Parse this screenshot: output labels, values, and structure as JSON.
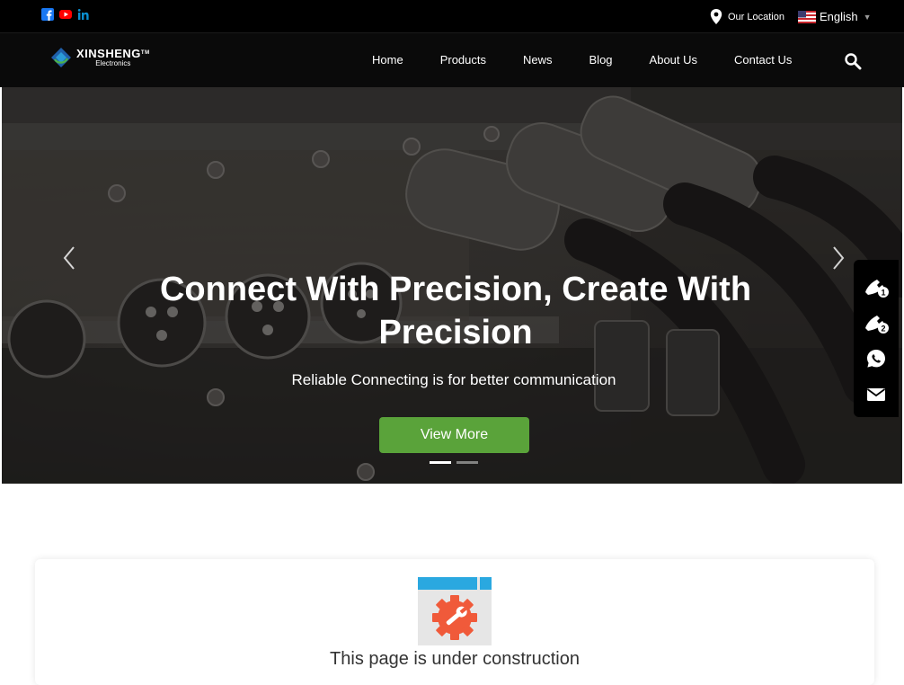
{
  "topbar": {
    "social": [
      "facebook-icon",
      "youtube-icon",
      "linkedin-icon"
    ],
    "location_label": "Our Location",
    "language_label": "English"
  },
  "header": {
    "logo": {
      "brand": "XINSHENG",
      "tm": "TM",
      "sub": "Electronics"
    },
    "nav": [
      {
        "label": "Home"
      },
      {
        "label": "Products"
      },
      {
        "label": "News"
      },
      {
        "label": "Blog"
      },
      {
        "label": "About Us"
      },
      {
        "label": "Contact Us"
      }
    ]
  },
  "hero": {
    "title": "Connect With Precision, Create With Precision",
    "subtitle": "Reliable Connecting is for better communication",
    "button_label": "View More",
    "slide_count": 2,
    "active_slide": 1
  },
  "float_contacts": [
    {
      "icon": "phone-1-icon",
      "badge": "1"
    },
    {
      "icon": "phone-2-icon",
      "badge": "2"
    },
    {
      "icon": "whatsapp-icon"
    },
    {
      "icon": "email-icon"
    }
  ],
  "notice": {
    "text": "This page is under construction"
  },
  "colors": {
    "accent_green": "#5aa33a",
    "header_bg": "#000000",
    "icon_blue": "#2aa8e0",
    "gear_orange": "#f05a3a"
  }
}
